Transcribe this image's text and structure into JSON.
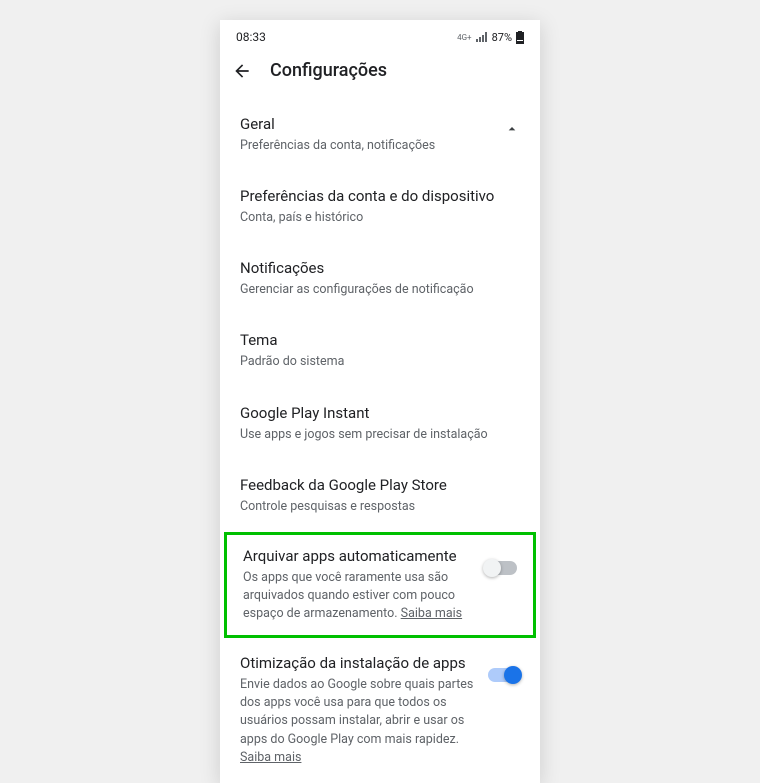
{
  "status": {
    "time": "08:33",
    "netLabel": "4G+",
    "battery": "87%"
  },
  "appbar": {
    "title": "Configurações"
  },
  "general": {
    "title": "Geral",
    "desc": "Preferências da conta, notificações"
  },
  "prefs": {
    "title": "Preferências da conta e do dispositivo",
    "desc": "Conta, país e histórico"
  },
  "notifications": {
    "title": "Notificações",
    "desc": "Gerenciar as configurações de notificação"
  },
  "theme": {
    "title": "Tema",
    "desc": "Padrão do sistema"
  },
  "instant": {
    "title": "Google Play Instant",
    "desc": "Use apps e jogos sem precisar de instalação"
  },
  "feedback": {
    "title": "Feedback da Google Play Store",
    "desc": "Controle pesquisas e respostas"
  },
  "archive": {
    "title": "Arquivar apps automaticamente",
    "desc": "Os apps que você raramente usa são arquivados quando estiver com pouco espaço de armazenamento. ",
    "link": "Saiba mais"
  },
  "optimize": {
    "title": "Otimização da instalação de apps",
    "desc": "Envie dados ao Google sobre quais partes dos apps você usa para que todos os usuários possam instalar, abrir e usar os apps do Google Play com mais rapidez. ",
    "link": "Saiba mais"
  }
}
